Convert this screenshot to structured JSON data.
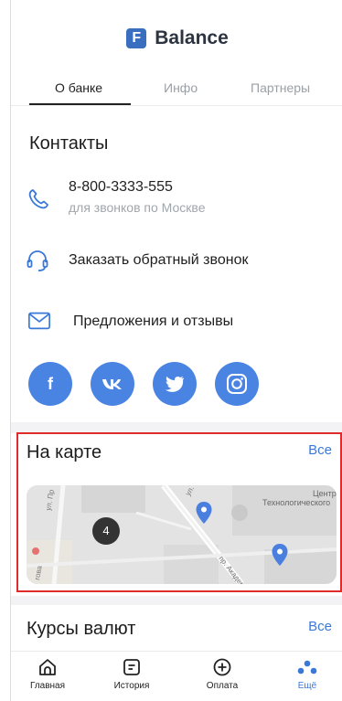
{
  "app": {
    "logo_letter": "F",
    "name": "Balance"
  },
  "tabs": [
    {
      "label": "О банке",
      "active": true
    },
    {
      "label": "Инфо",
      "active": false
    },
    {
      "label": "Партнеры",
      "active": false
    }
  ],
  "contacts": {
    "title": "Контакты",
    "phone": {
      "number": "8-800-3333-555",
      "note": "для звонков по Москве",
      "icon": "phone-icon"
    },
    "callback": {
      "label": "Заказать обратный звонок",
      "icon": "headset-icon"
    },
    "feedback": {
      "label": "Предложения и отзывы",
      "icon": "mail-icon"
    },
    "social": [
      {
        "name": "facebook",
        "glyph": "f"
      },
      {
        "name": "vk",
        "glyph": "vk"
      },
      {
        "name": "twitter",
        "glyph": "twitter"
      },
      {
        "name": "instagram",
        "glyph": "instagram"
      }
    ]
  },
  "map_section": {
    "title": "На карте",
    "all_link": "Все",
    "cluster_count": "4",
    "street_labels": [
      "ул. Пр",
      "ул. Ник",
      "пр. Академ",
      "Центр",
      "Технологического",
      "гова"
    ]
  },
  "currency_section": {
    "title": "Курсы валют",
    "all_link": "Все"
  },
  "bottom_nav": [
    {
      "label": "Главная",
      "icon": "home-icon",
      "active": false
    },
    {
      "label": "История",
      "icon": "history-icon",
      "active": false
    },
    {
      "label": "Оплата",
      "icon": "payment-plus-icon",
      "active": false
    },
    {
      "label": "Ещё",
      "icon": "more-dots-icon",
      "active": true
    }
  ],
  "colors": {
    "accent": "#3a78d8",
    "social_bg": "#4a84e2",
    "highlight_border": "#e02b2b",
    "map_pin": "#4a7fe0",
    "logo": "#3a6fbf"
  }
}
